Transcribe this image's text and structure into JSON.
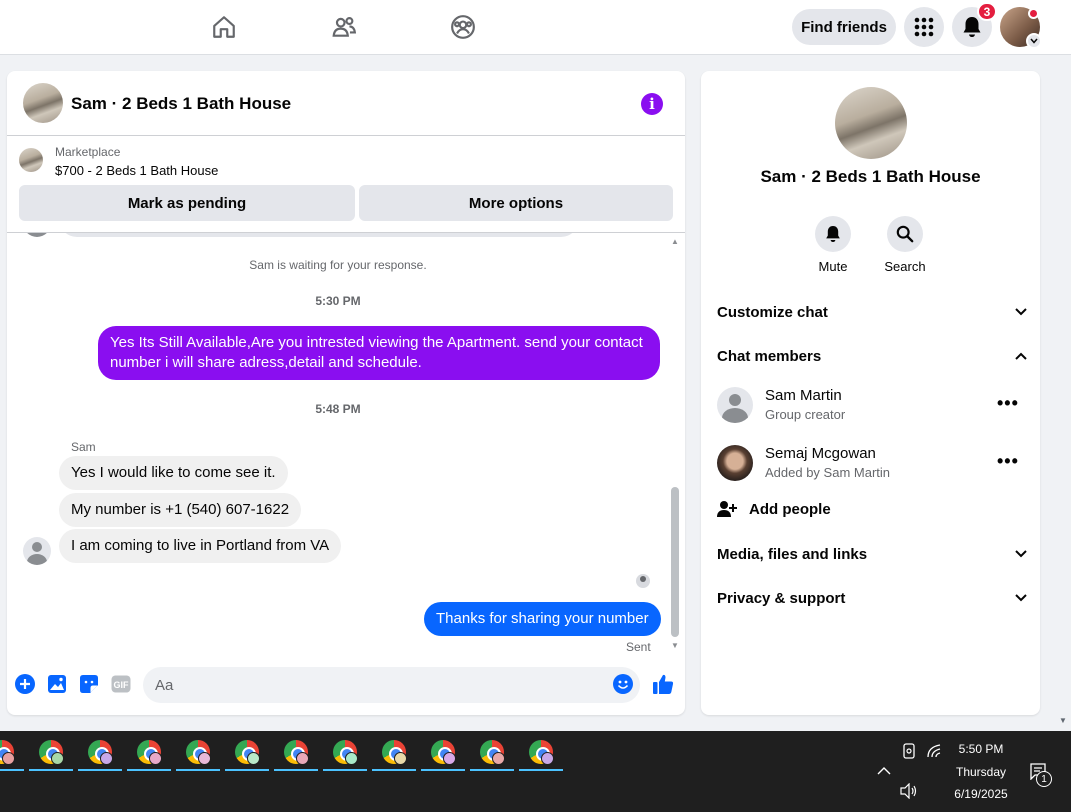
{
  "topbar": {
    "find_friends": "Find friends",
    "notification_count": "3"
  },
  "chat": {
    "title": "Sam · 2 Beds 1 Bath House",
    "marketplace_label": "Marketplace",
    "marketplace_item": "$700 - 2 Beds 1 Bath House",
    "mark_pending": "Mark as pending",
    "more_options": "More options",
    "waiting_notice": "Sam is waiting for your response.",
    "time_1": "5:30 PM",
    "outgoing_1": "Yes Its Still Available,Are you intrested viewing the Apartment. send your contact number i will share adress,detail and schedule.",
    "time_2": "5:48 PM",
    "sender_name": "Sam",
    "incoming": [
      "Yes I would like to come see it.",
      "My number is +1 (540) 607-1622",
      "I am coming to live in Portland from VA"
    ],
    "outgoing_2": "Thanks for sharing your number",
    "sent_status": "Sent",
    "composer_placeholder": "Aa",
    "gif_label": "GIF"
  },
  "info_panel": {
    "name": "Sam · 2 Beds 1 Bath House",
    "mute": "Mute",
    "search": "Search",
    "customize_chat": "Customize chat",
    "chat_members": "Chat members",
    "members": [
      {
        "name": "Sam Martin",
        "role": "Group creator"
      },
      {
        "name": "Semaj Mcgowan",
        "role": "Added by Sam Martin"
      }
    ],
    "add_people": "Add people",
    "media_files_links": "Media, files and links",
    "privacy_support": "Privacy & support"
  },
  "taskbar": {
    "time": "5:50 PM",
    "day": "Thursday",
    "date": "6/19/2025",
    "notification_count": "1"
  },
  "colors": {
    "accent_purple": "#8a0ef0",
    "messenger_blue": "#0866ff",
    "notification_red": "#e41e3f"
  }
}
